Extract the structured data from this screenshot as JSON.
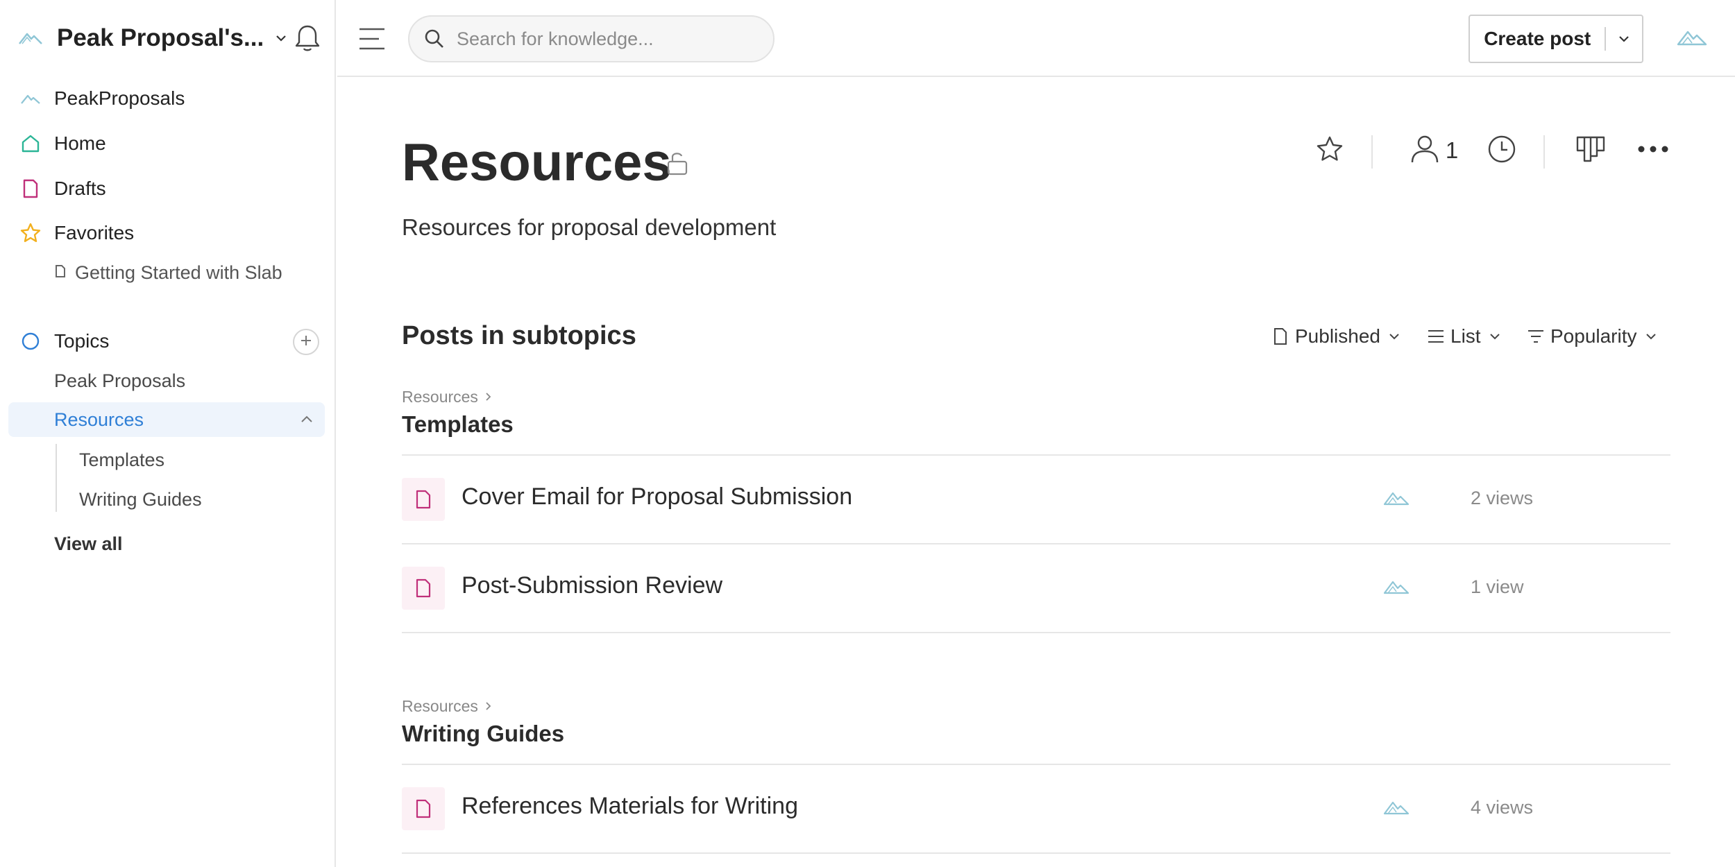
{
  "workspace": {
    "name": "Peak Proposal's..."
  },
  "sidebar": {
    "nav": [
      {
        "label": "PeakProposals",
        "icon": "mountain-logo-icon"
      },
      {
        "label": "Home",
        "icon": "home-icon"
      },
      {
        "label": "Drafts",
        "icon": "drafts-icon"
      },
      {
        "label": "Favorites",
        "icon": "star-icon"
      }
    ],
    "favorites": [
      {
        "label": "Getting Started with Slab",
        "icon": "doc-icon"
      }
    ],
    "topics_label": "Topics",
    "topics": [
      {
        "label": "Peak Proposals"
      },
      {
        "label": "Resources"
      }
    ],
    "subtopics": [
      {
        "label": "Templates"
      },
      {
        "label": "Writing Guides"
      }
    ],
    "view_all": "View all"
  },
  "topbar": {
    "search_placeholder": "Search for knowledge...",
    "create_post_label": "Create post"
  },
  "page": {
    "title": "Resources",
    "description": "Resources for proposal development",
    "member_count": "1"
  },
  "posts_section": {
    "title": "Posts in subtopics",
    "filters": {
      "status": "Published",
      "layout": "List",
      "sort": "Popularity"
    },
    "groups": [
      {
        "breadcrumb": "Resources",
        "title": "Templates",
        "posts": [
          {
            "title": "Cover Email for Proposal Submission",
            "views": "2 views"
          },
          {
            "title": "Post-Submission Review",
            "views": "1 view"
          }
        ]
      },
      {
        "breadcrumb": "Resources",
        "title": "Writing Guides",
        "posts": [
          {
            "title": "References Materials for Writing",
            "views": "4 views"
          }
        ]
      }
    ]
  },
  "colors": {
    "accent_blue": "#2f7fd6",
    "home_green": "#2bb596",
    "drafts_pink": "#c0307a",
    "favorites_yellow": "#f2b01e",
    "logo_teal": "#8fc6d6"
  }
}
